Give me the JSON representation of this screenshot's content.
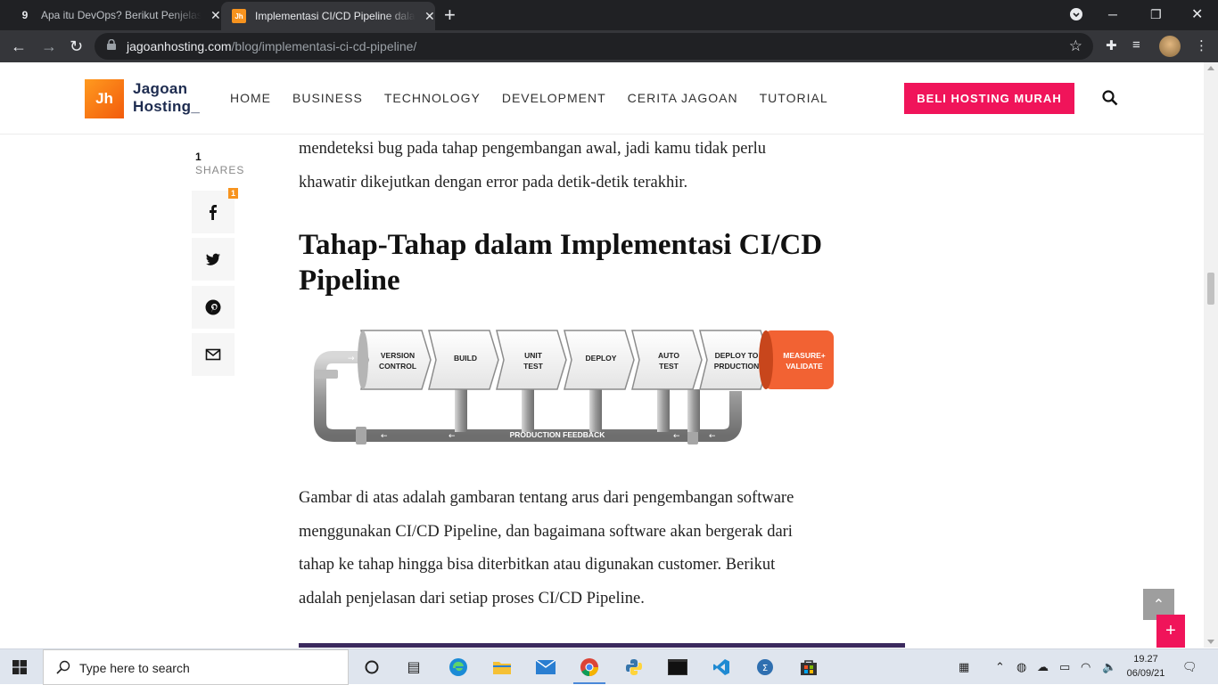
{
  "browser": {
    "tabs": [
      {
        "title": "Apa itu DevOps? Berikut Penjelas",
        "active": false
      },
      {
        "title": "Implementasi CI/CD Pipeline dala",
        "active": true
      }
    ],
    "new_tab": "+",
    "url_domain": "jagoanhosting.com",
    "url_path": "/blog/implementasi-ci-cd-pipeline/"
  },
  "site": {
    "logo_mark": "Jh",
    "logo_line1": "Jagoan",
    "logo_line2": "Hosting_",
    "nav": [
      "HOME",
      "BUSINESS",
      "TECHNOLOGY",
      "DEVELOPMENT",
      "CERITA JAGOAN",
      "TUTORIAL"
    ],
    "cta": "BELI HOSTING MURAH"
  },
  "share": {
    "count": "1",
    "label": "SHARES",
    "facebook_badge": "1",
    "buttons": [
      "facebook-icon",
      "twitter-icon",
      "pinterest-icon",
      "mail-icon"
    ]
  },
  "article": {
    "intro_lines": [
      "mendeteksi bug pada tahap pengembangan awal, jadi kamu tidak perlu",
      "khawatir dikejutkan dengan error pada detik-detik terakhir."
    ],
    "heading_lines": [
      "Tahap-Tahap dalam Implementasi CI/CD",
      "Pipeline"
    ],
    "body_lines": [
      "Gambar di atas adalah gambaran tentang arus dari pengembangan software",
      "menggunakan CI/CD Pipeline, dan bagaimana software akan bergerak dari",
      "tahap ke tahap hingga bisa diterbitkan atau digunakan customer. Berikut",
      "adalah penjelasan dari setiap proses CI/CD Pipeline."
    ]
  },
  "diagram": {
    "stages": [
      [
        "VERSION",
        "CONTROL"
      ],
      [
        "BUILD"
      ],
      [
        "UNIT",
        "TEST"
      ],
      [
        "DEPLOY"
      ],
      [
        "AUTO",
        "TEST"
      ],
      [
        "DEPLOY TO",
        "PRDUCTION"
      ]
    ],
    "final_stage": [
      "MEASURE+",
      "VALIDATE"
    ],
    "feedback_label": "PRODUCTION FEEDBACK",
    "final_color": "#f26233"
  },
  "taskbar": {
    "search_placeholder": "Type here to search",
    "time": "19.27",
    "date": "06/09/21"
  },
  "colors": {
    "accent": "#f0145a",
    "logo": "#f7931e"
  }
}
